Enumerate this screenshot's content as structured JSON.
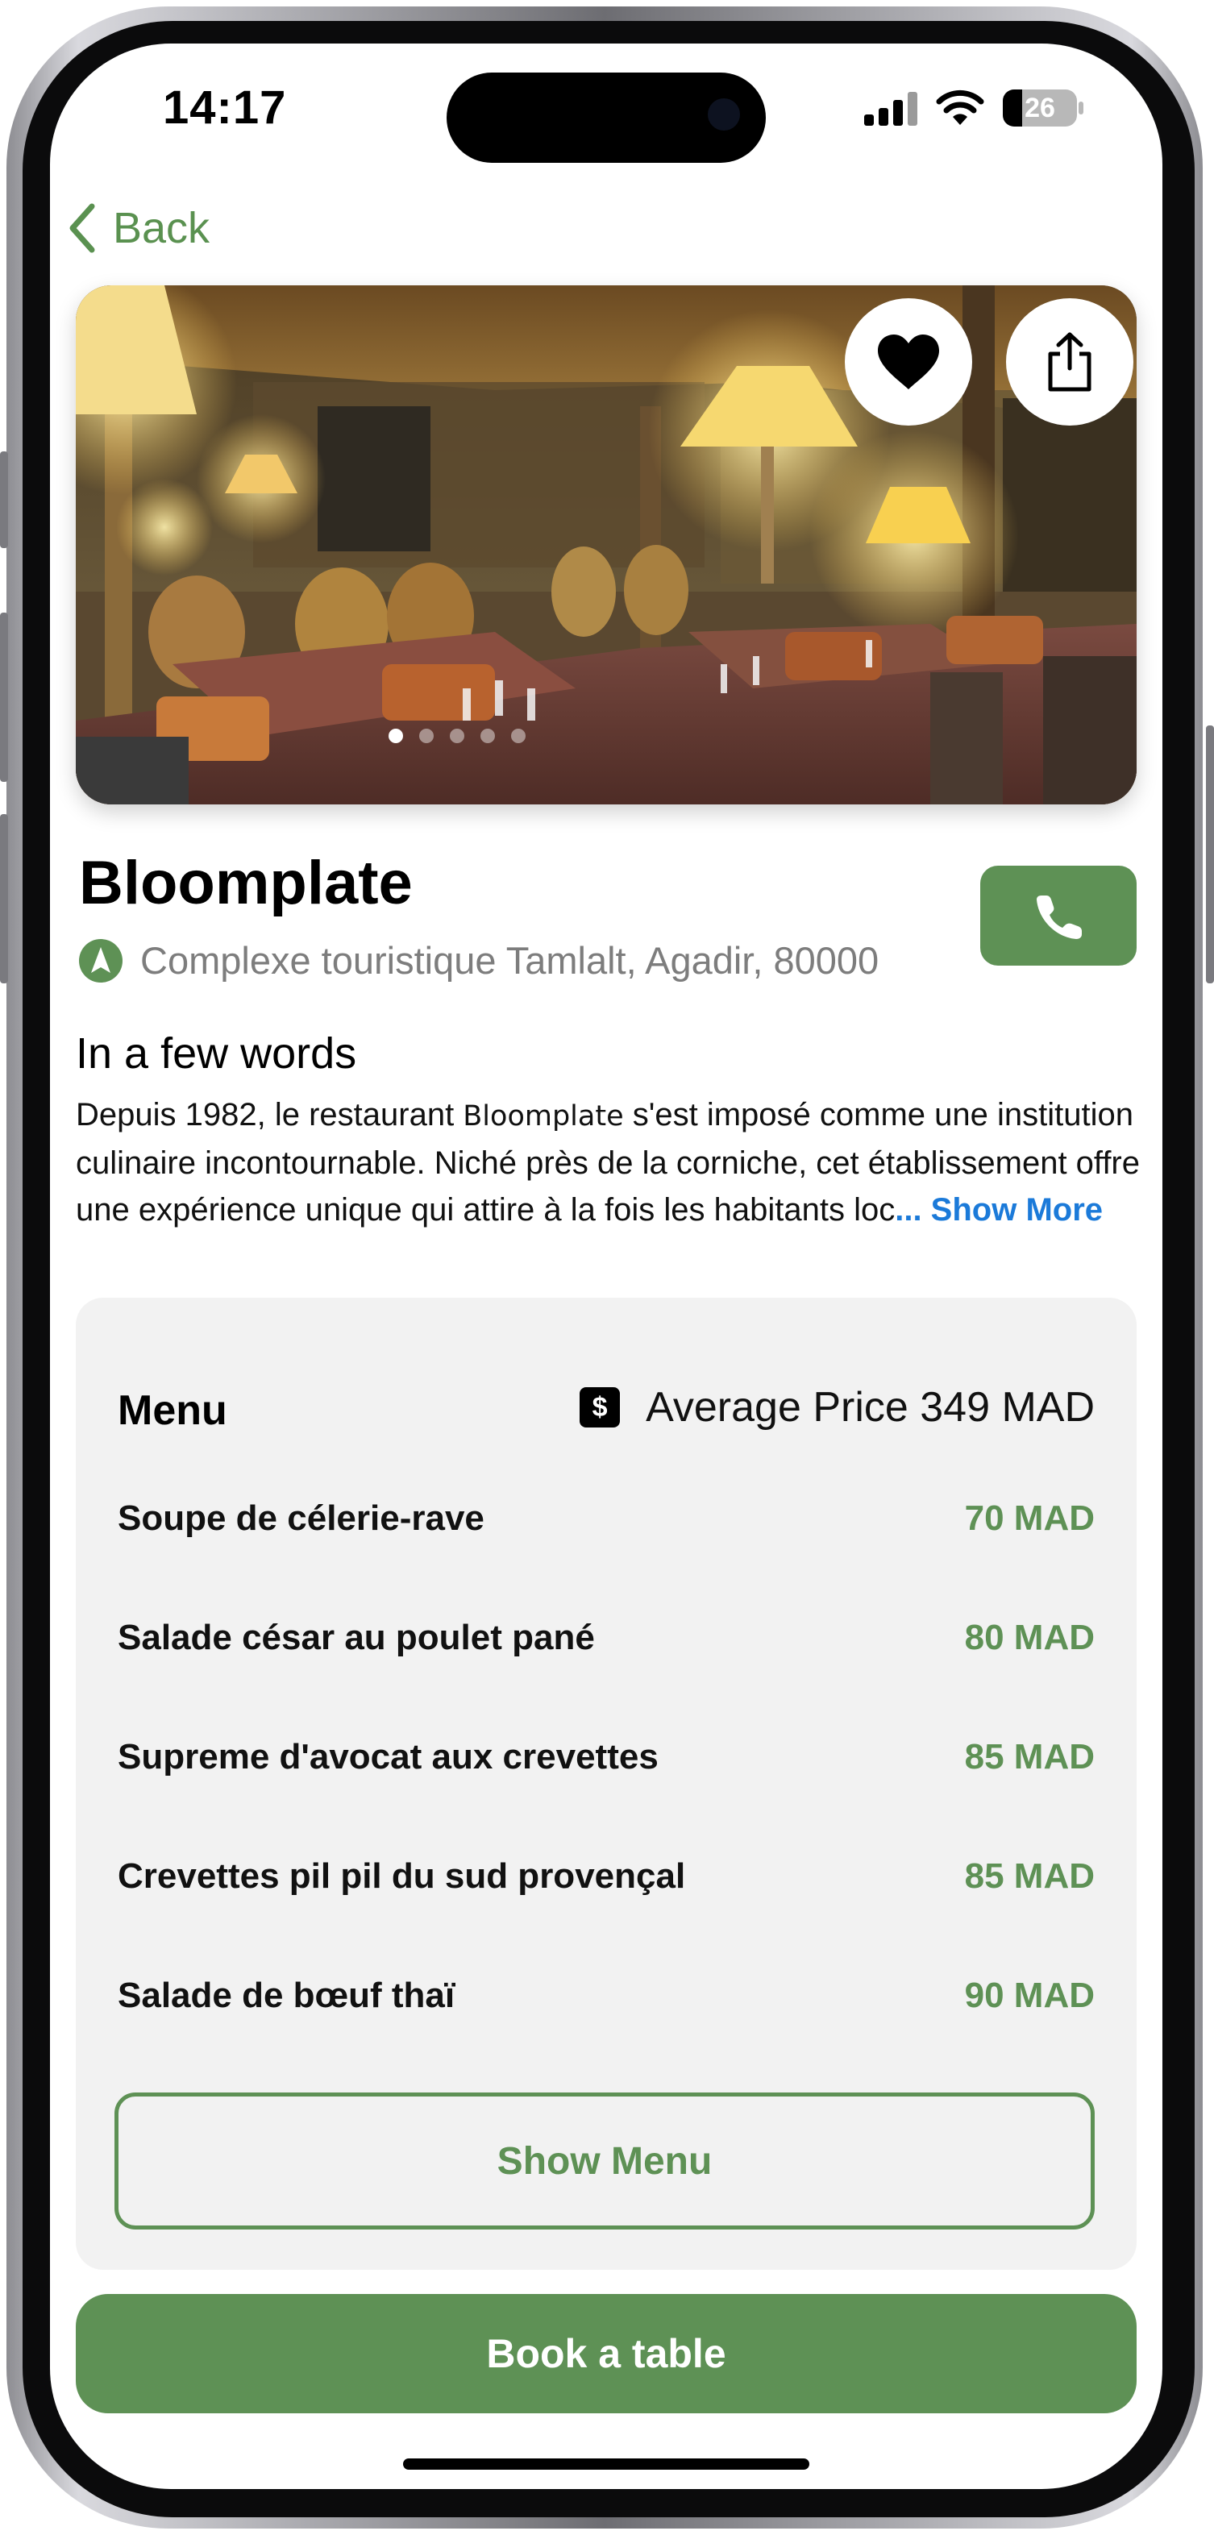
{
  "status_bar": {
    "time": "14:17",
    "battery": "26",
    "battery_level": 0.26
  },
  "nav": {
    "back_label": "Back"
  },
  "hero": {
    "image_alt": "Restaurant interior with lamps and set tables",
    "slides": 5,
    "active_slide": 1
  },
  "restaurant": {
    "name": "Bloomplate",
    "address": "Complexe touristique Tamlalt, Agadir, 80000"
  },
  "about": {
    "heading": "In a few words",
    "text_before": "Depuis 1982, le restaurant ",
    "brand": "Bloomplate",
    "text_after": " s'est imposé comme une institution culinaire incontournable. Niché près de la corniche, cet établissement offre une expérience unique qui attire à la fois les habitants loc",
    "show_more": "... Show More"
  },
  "menu": {
    "title": "Menu",
    "avg_icon": "$",
    "avg_price": "Average Price 349 MAD",
    "items": [
      {
        "name": "Soupe de célerie-rave",
        "price": "70 MAD"
      },
      {
        "name": "Salade césar au poulet pané",
        "price": "80 MAD"
      },
      {
        "name": "Supreme d'avocat aux crevettes",
        "price": "85 MAD"
      },
      {
        "name": "Crevettes pil pil du sud provençal",
        "price": "85 MAD"
      },
      {
        "name": "Salade de bœuf thaï",
        "price": "90 MAD"
      }
    ],
    "show_menu": "Show Menu"
  },
  "cta": {
    "book": "Book a table"
  },
  "colors": {
    "accent": "#5e9155",
    "link": "#1b7ad9",
    "card": "#f2f2f2"
  },
  "icons": [
    "back-chevron-icon",
    "heart-icon",
    "share-icon",
    "phone-icon",
    "location-arrow-icon",
    "dollar-icon"
  ]
}
